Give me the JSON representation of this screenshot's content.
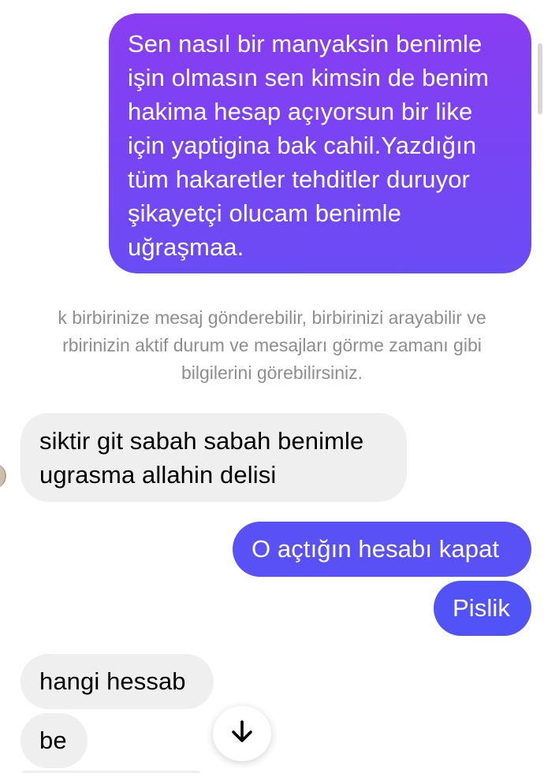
{
  "messages": {
    "sent_1": "Sen nasıl bir manyaksin benimle\nişin olmasın sen kimsin de benim\nhakima hesap açıyorsun bir like\niçin yaptigina bak cahil.Yazdığın\ntüm hakaretler tehditler duruyor\nşikayetçi olucam benimle\nuğraşmaa.",
    "system_notice": "k birbirinize mesaj gönderebilir, birbirinizi arayabilir ve\nrbirinizin aktif durum ve mesajları görme zamanı gibi\nbilgilerini görebilirsiniz.",
    "received_1": "siktir git sabah sabah benimle\nugrasma allahin delisi",
    "sent_2": "O açtığın hesabı kapat",
    "sent_3": "Pislik",
    "received_2": "hangi hessab",
    "received_3": "be"
  },
  "icons": {
    "scroll_down": "arrow-down-icon"
  },
  "colors": {
    "sent_gradient_top": "#8a3df2",
    "sent_gradient_bottom": "#6a4cf5",
    "sent_solid": "#5951f5",
    "received_bg": "#efefef",
    "system_text": "#8e8e8e"
  }
}
